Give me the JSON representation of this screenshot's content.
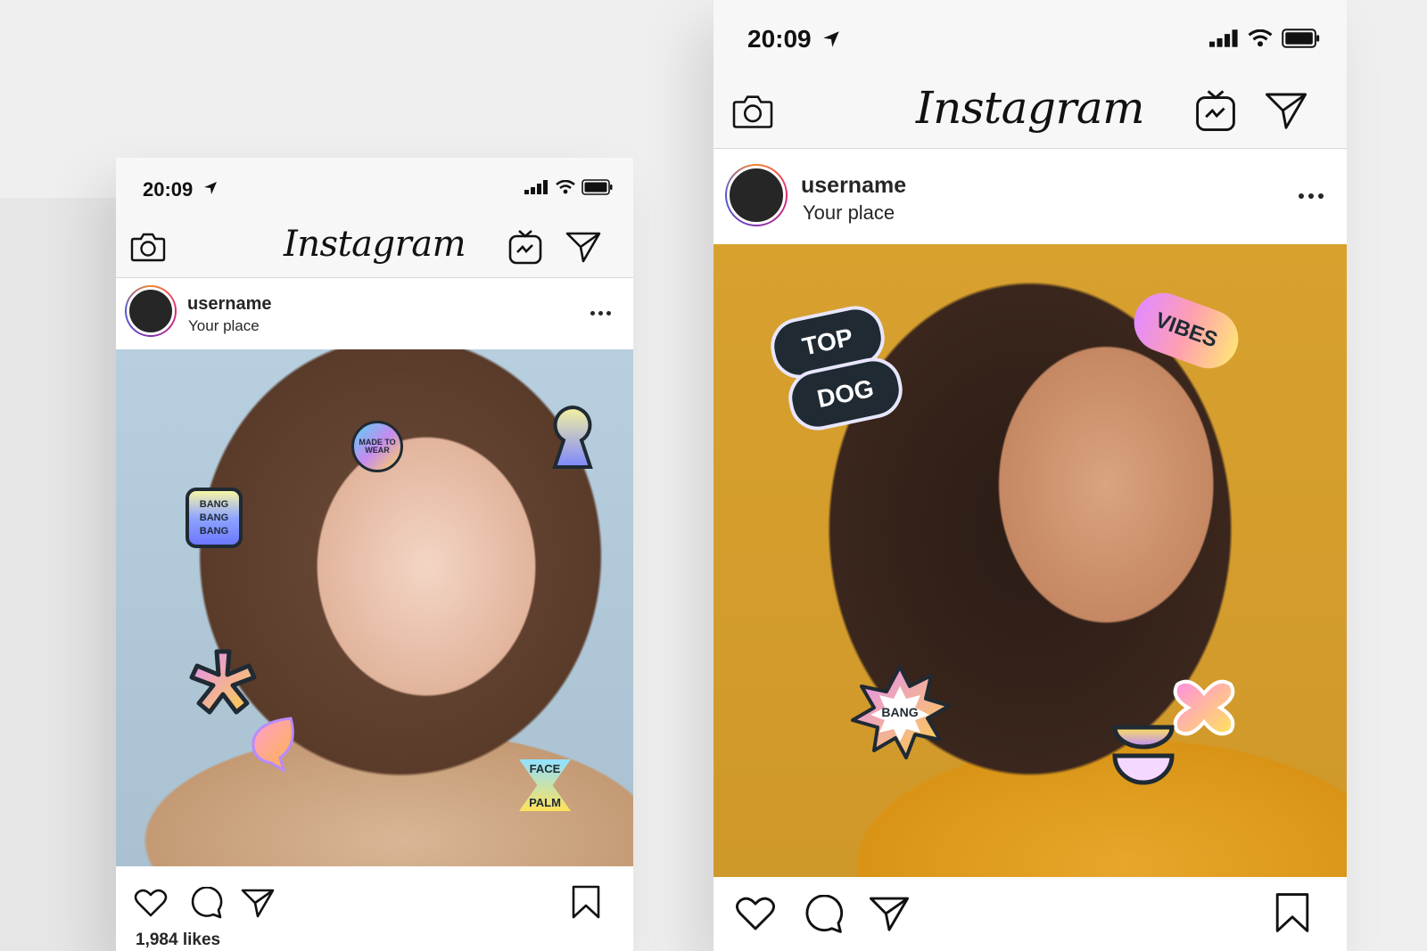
{
  "left_phone": {
    "status": {
      "time": "20:09"
    },
    "nav": {
      "logo": "Instagram"
    },
    "post": {
      "username": "username",
      "place": "Your place",
      "stickers": {
        "made_to_wear": "MADE TO WEAR",
        "bang_bang_bang": "BANG BANG BANG",
        "face_palm_top": "FACE",
        "face_palm_bottom": "PALM"
      },
      "likes": "1,984 likes"
    }
  },
  "right_phone": {
    "status": {
      "time": "20:09"
    },
    "nav": {
      "logo": "Instagram"
    },
    "post": {
      "username": "username",
      "place": "Your place",
      "stickers": {
        "top": "TOP",
        "dog": "DOG",
        "vibes": "VIBES",
        "bang": "BANG"
      }
    }
  },
  "colors": {
    "left_photo_bg": "#aec6d6",
    "right_photo_bg": "#cf982a",
    "sticker_outline": "#1f2a33"
  },
  "icons": [
    "camera-icon",
    "igtv-icon",
    "direct-icon",
    "location-arrow-icon",
    "signal-icon",
    "wifi-icon",
    "battery-icon",
    "heart-icon",
    "comment-icon",
    "share-icon",
    "bookmark-icon",
    "more-icon"
  ]
}
